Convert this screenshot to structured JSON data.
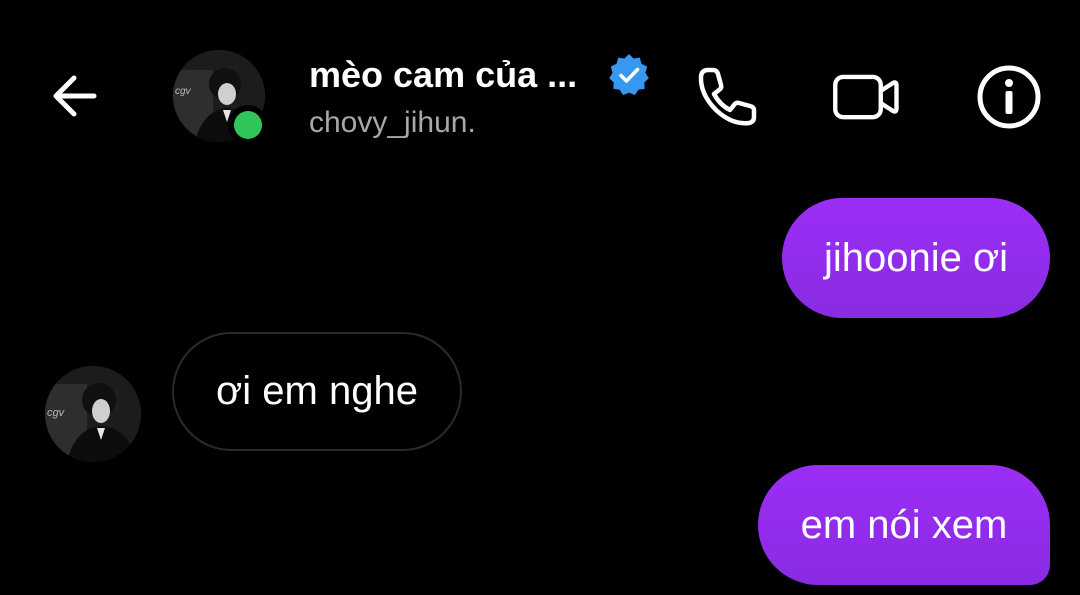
{
  "header": {
    "back_icon": "arrow-left-icon",
    "title": "mèo cam của ...",
    "verified_icon": "verified-badge-icon",
    "subtitle": "chovy_jihun.",
    "status": "online",
    "actions": {
      "call_icon": "phone-icon",
      "video_icon": "video-camera-icon",
      "info_icon": "info-icon"
    }
  },
  "colors": {
    "background": "#000000",
    "outgoing_bubble": "#9b2ef6",
    "incoming_border": "#2a2a2a",
    "online": "#2fc55a",
    "verified": "#3897f0",
    "subtitle": "#a8a8a8"
  },
  "messages": [
    {
      "direction": "outgoing",
      "text": "jihoonie ơi"
    },
    {
      "direction": "incoming",
      "text": "ơi em nghe"
    },
    {
      "direction": "outgoing",
      "text": "em nói xem"
    }
  ]
}
